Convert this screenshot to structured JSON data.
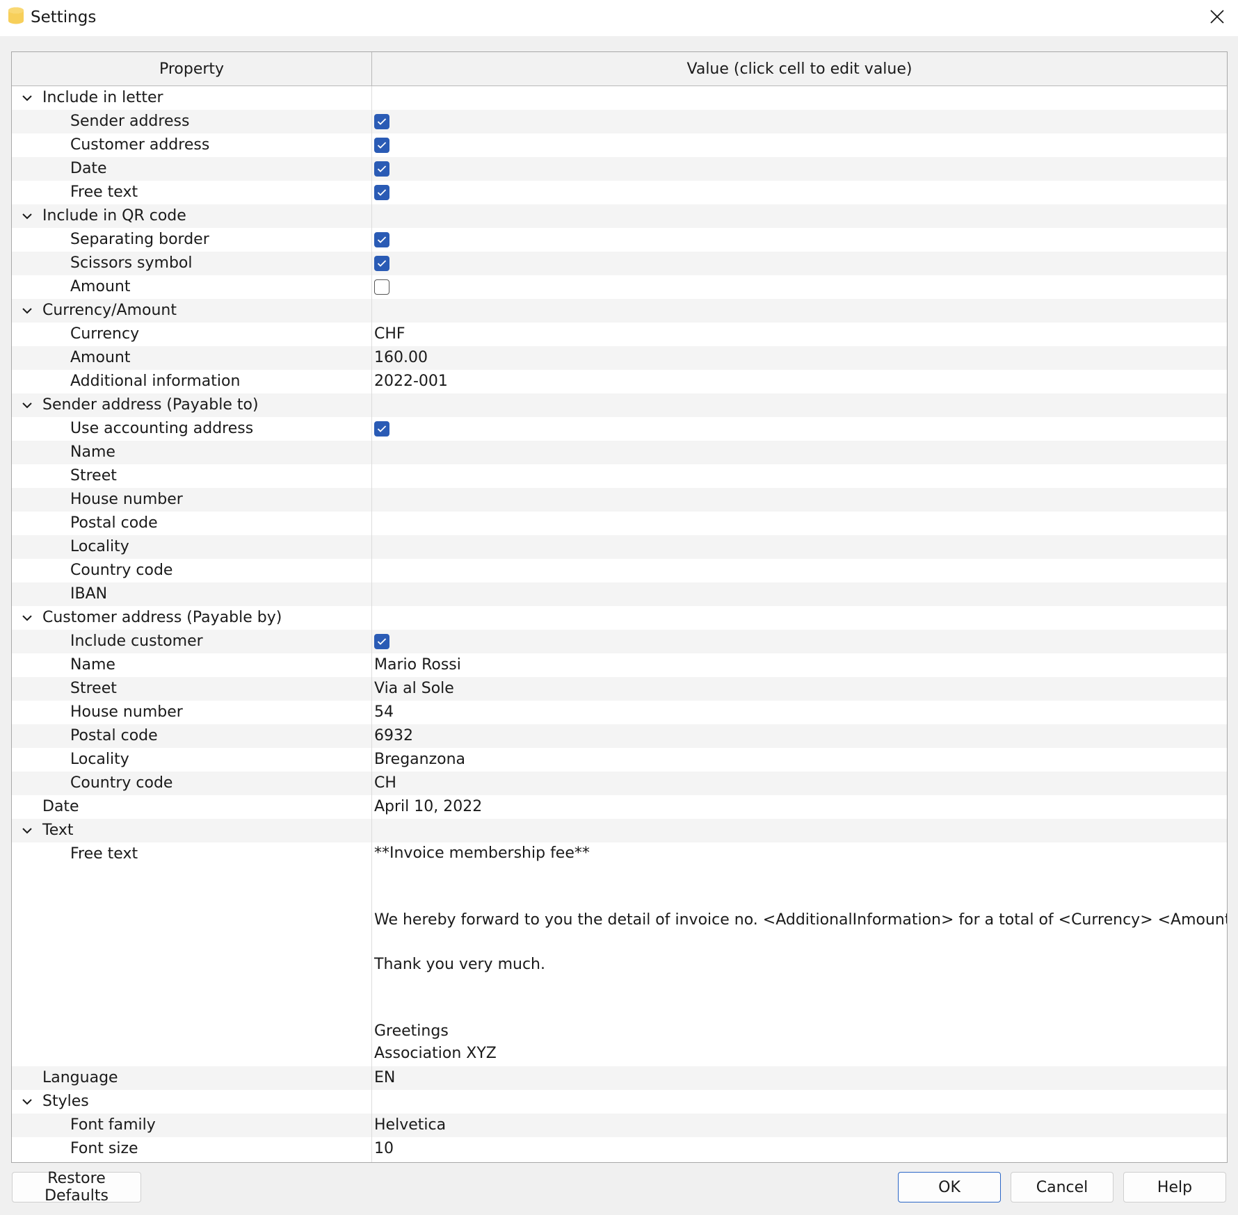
{
  "window": {
    "title": "Settings"
  },
  "grid": {
    "header_property": "Property",
    "header_value": "Value (click cell to edit value)"
  },
  "rows": [
    {
      "level": 0,
      "expand": true,
      "label": "Include in letter",
      "type": "group"
    },
    {
      "level": 1,
      "label": "Sender address",
      "type": "checkbox",
      "checked": true
    },
    {
      "level": 1,
      "label": "Customer address",
      "type": "checkbox",
      "checked": true
    },
    {
      "level": 1,
      "label": "Date",
      "type": "checkbox",
      "checked": true
    },
    {
      "level": 1,
      "label": "Free text",
      "type": "checkbox",
      "checked": true
    },
    {
      "level": 0,
      "expand": true,
      "label": "Include in QR code",
      "type": "group"
    },
    {
      "level": 1,
      "label": "Separating border",
      "type": "checkbox",
      "checked": true
    },
    {
      "level": 1,
      "label": "Scissors symbol",
      "type": "checkbox",
      "checked": true
    },
    {
      "level": 1,
      "label": "Amount",
      "type": "checkbox",
      "checked": false
    },
    {
      "level": 0,
      "expand": true,
      "label": "Currency/Amount",
      "type": "group"
    },
    {
      "level": 1,
      "label": "Currency",
      "type": "text",
      "value": "CHF"
    },
    {
      "level": 1,
      "label": "Amount",
      "type": "text",
      "value": "160.00"
    },
    {
      "level": 1,
      "label": "Additional information",
      "type": "text",
      "value": "2022-001"
    },
    {
      "level": 0,
      "expand": true,
      "label": "Sender address (Payable to)",
      "type": "group"
    },
    {
      "level": 1,
      "label": "Use accounting address",
      "type": "checkbox",
      "checked": true
    },
    {
      "level": 1,
      "label": "Name",
      "type": "text",
      "value": ""
    },
    {
      "level": 1,
      "label": "Street",
      "type": "text",
      "value": ""
    },
    {
      "level": 1,
      "label": "House number",
      "type": "text",
      "value": ""
    },
    {
      "level": 1,
      "label": "Postal code",
      "type": "text",
      "value": ""
    },
    {
      "level": 1,
      "label": "Locality",
      "type": "text",
      "value": ""
    },
    {
      "level": 1,
      "label": "Country code",
      "type": "text",
      "value": ""
    },
    {
      "level": 1,
      "label": "IBAN",
      "type": "text",
      "value": ""
    },
    {
      "level": 0,
      "expand": true,
      "label": "Customer address (Payable by)",
      "type": "group"
    },
    {
      "level": 1,
      "label": "Include customer",
      "type": "checkbox",
      "checked": true
    },
    {
      "level": 1,
      "label": "Name",
      "type": "text",
      "value": "Mario Rossi"
    },
    {
      "level": 1,
      "label": "Street",
      "type": "text",
      "value": "Via al Sole"
    },
    {
      "level": 1,
      "label": "House number",
      "type": "text",
      "value": "54"
    },
    {
      "level": 1,
      "label": "Postal code",
      "type": "text",
      "value": "6932"
    },
    {
      "level": 1,
      "label": "Locality",
      "type": "text",
      "value": "Breganzona"
    },
    {
      "level": 1,
      "label": "Country code",
      "type": "text",
      "value": "CH"
    },
    {
      "level": 0,
      "expand": false,
      "label": "Date",
      "type": "text",
      "value": "April 10, 2022"
    },
    {
      "level": 0,
      "expand": true,
      "label": "Text",
      "type": "group"
    },
    {
      "level": 1,
      "label": "Free text",
      "type": "freetext",
      "lines": [
        "**Invoice membership fee**",
        "",
        "",
        "We hereby forward to you the detail of invoice no. <AdditionalInformation> for a total of <Currency> <Amount>.",
        "",
        "Thank you very much.",
        "",
        "",
        "Greetings",
        "Association XYZ"
      ]
    },
    {
      "level": 0,
      "expand": false,
      "label": "Language",
      "type": "text",
      "value": "EN"
    },
    {
      "level": 0,
      "expand": true,
      "label": "Styles",
      "type": "group"
    },
    {
      "level": 1,
      "label": "Font family",
      "type": "text",
      "value": "Helvetica"
    },
    {
      "level": 1,
      "label": "Font size",
      "type": "text",
      "value": "10"
    }
  ],
  "buttons": {
    "restore_defaults": "Restore Defaults",
    "ok": "OK",
    "cancel": "Cancel",
    "help": "Help"
  },
  "colors": {
    "checkbox_checked": "#2a5bb5",
    "ok_border": "#2a66c6",
    "app_icon": "#f5c542"
  },
  "icons": {
    "app": "banana-app-icon",
    "close": "close-icon",
    "expand": "chevron-down-icon",
    "check": "checkmark-icon"
  }
}
